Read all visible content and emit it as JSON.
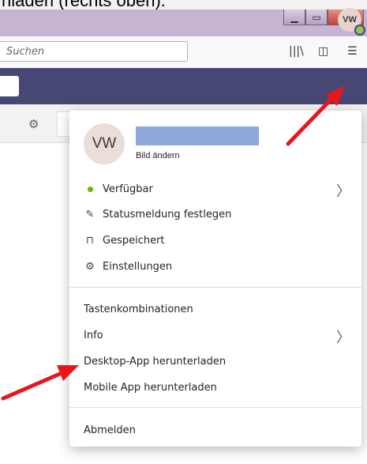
{
  "caption": "nladen (rechts oben).",
  "browser": {
    "search_placeholder": "Suchen",
    "library_icon": "library-icon",
    "sidebar_icon": "sidebar-icon",
    "menu_icon": "hamburger-icon"
  },
  "header": {
    "avatar_initials": "VW"
  },
  "profile": {
    "initials": "VW",
    "change_picture": "Bild ändern"
  },
  "menu": {
    "status": "Verfügbar",
    "status_message": "Statusmeldung festlegen",
    "saved": "Gespeichert",
    "settings": "Einstellungen",
    "shortcuts": "Tastenkombinationen",
    "info": "Info",
    "desktop_app": "Desktop-App herunterladen",
    "mobile_app": "Mobile App herunterladen",
    "sign_out": "Abmelden"
  },
  "colors": {
    "header": "#464775",
    "available": "#6bb700",
    "arrow": "#e8161b"
  }
}
